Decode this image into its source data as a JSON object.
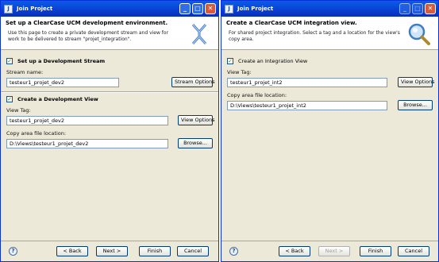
{
  "window_left": {
    "title": "Join Project",
    "header": {
      "title": "Set up a ClearCase UCM development environment.",
      "desc": "Use this page to create a private development stream and view for work to be delivered to stream \"projet_integration\"."
    },
    "stream_section": {
      "checkbox_label": "Set up a Development Stream",
      "checked": true,
      "stream_name_label": "Stream name:",
      "stream_name_value": "testeur1_projet_dev2",
      "stream_options_label": "Stream Options"
    },
    "view_section": {
      "checkbox_label": "Create a Development View",
      "checked": true,
      "view_tag_label": "View Tag:",
      "view_tag_value": "testeur1_projet_dev2",
      "view_options_label": "View Options",
      "copy_area_label": "Copy area file location:",
      "copy_area_value": "D:\\Views\\testeur1_projet_dev2",
      "browse_label": "Browse..."
    },
    "footer": {
      "back": "< Back",
      "next": "Next >",
      "finish": "Finish",
      "cancel": "Cancel"
    }
  },
  "window_right": {
    "title": "Join Project",
    "header": {
      "title": "Create a ClearCase UCM integration view.",
      "desc": "For shared project integration. Select a tag and a location for the view's copy area."
    },
    "integration_section": {
      "checkbox_label": "Create an Integration View",
      "checked": true,
      "view_tag_label": "View Tag:",
      "view_tag_value": "testeur1_projet_int2",
      "view_options_label": "View Options",
      "copy_area_label": "Copy area file location:",
      "copy_area_value": "D:\\Views\\testeur1_projet_int2",
      "browse_label": "Browse..."
    },
    "footer": {
      "back": "< Back",
      "next": "Next >",
      "finish": "Finish",
      "cancel": "Cancel"
    }
  }
}
